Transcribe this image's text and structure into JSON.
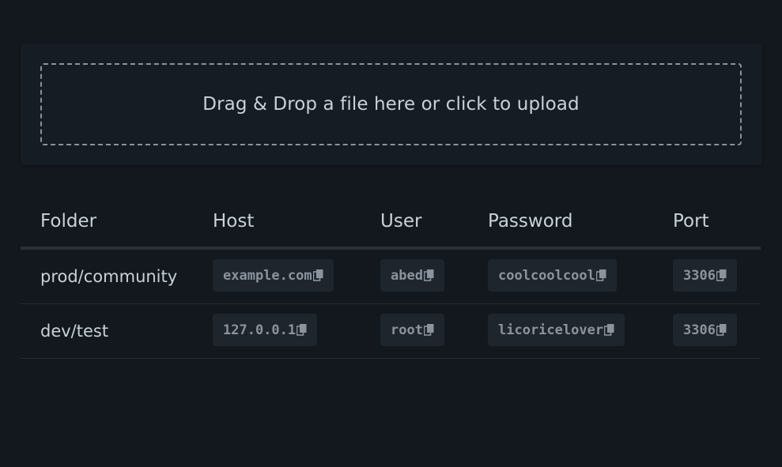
{
  "upload": {
    "prompt": "Drag & Drop a file here or click to upload"
  },
  "table": {
    "headers": [
      "Folder",
      "Host",
      "User",
      "Password",
      "Port"
    ],
    "rows": [
      {
        "folder": "prod/community",
        "host": "example.com",
        "user": "abed",
        "password": "coolcoolcool",
        "port": "3306"
      },
      {
        "folder": "dev/test",
        "host": "127.0.0.1",
        "user": "root",
        "password": "licoricelover",
        "port": "3306"
      }
    ]
  },
  "icons": {
    "copy": "copy-icon"
  },
  "colors": {
    "background": "#13181e",
    "card": "#161c23",
    "chip": "#1e252d",
    "text": "#c9d1d9",
    "chip_text": "#8b939c"
  }
}
